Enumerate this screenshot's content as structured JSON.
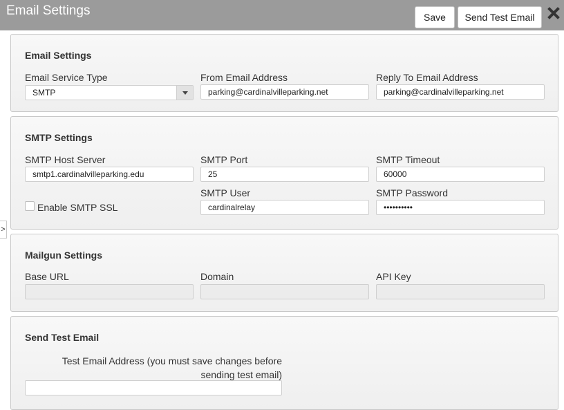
{
  "window": {
    "title": "Email Settings",
    "save_label": "Save",
    "send_test_label": "Send Test Email",
    "close_icon": "close-icon",
    "side_toggle": ">"
  },
  "email_settings": {
    "title": "Email Settings",
    "service_type_label": "Email Service Type",
    "service_type_value": "SMTP",
    "from_label": "From Email Address",
    "from_value": "parking@cardinalvilleparking.net",
    "reply_to_label": "Reply To Email Address",
    "reply_to_value": "parking@cardinalvilleparking.net"
  },
  "smtp_settings": {
    "title": "SMTP Settings",
    "host_label": "SMTP Host Server",
    "host_value": "smtp1.cardinalvilleparking.edu",
    "port_label": "SMTP Port",
    "port_value": "25",
    "timeout_label": "SMTP Timeout",
    "timeout_value": "60000",
    "ssl_label": "Enable SMTP SSL",
    "ssl_checked": false,
    "user_label": "SMTP User",
    "user_value": "cardinalrelay",
    "password_label": "SMTP Password",
    "password_value": "••••••••••"
  },
  "mailgun_settings": {
    "title": "Mailgun Settings",
    "base_url_label": "Base URL",
    "base_url_value": "",
    "domain_label": "Domain",
    "domain_value": "",
    "api_key_label": "API Key",
    "api_key_value": ""
  },
  "send_test_email": {
    "title": "Send Test Email",
    "address_label_line1": "Test Email Address (you must save changes before",
    "address_label_line2": "sending test email)",
    "address_value": ""
  },
  "colors": {
    "titlebar": "#9b9b9b",
    "panel_border": "#c8c8c8",
    "disabled_field": "#ececec"
  }
}
